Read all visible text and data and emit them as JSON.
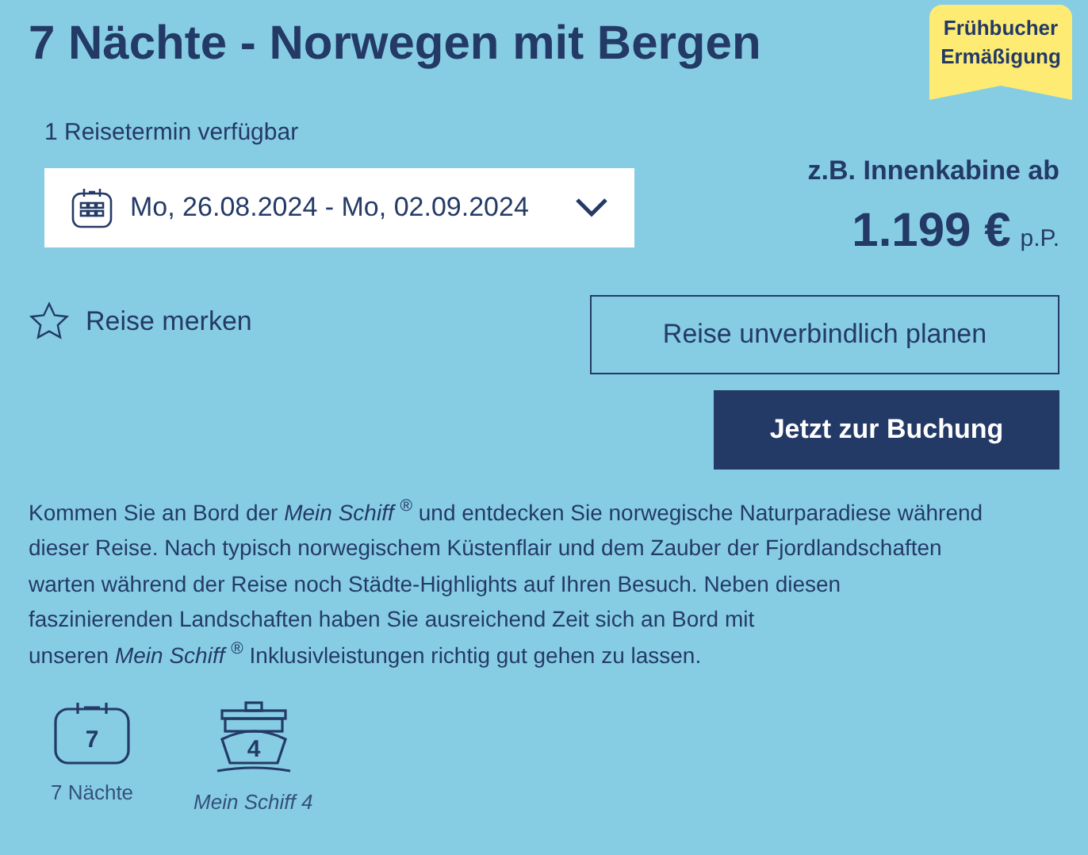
{
  "title": "7 Nächte - Norwegen mit Bergen",
  "badge": [
    "Frühbucher",
    "Ermäßigung"
  ],
  "availability": "1 Reisetermin verfügbar",
  "date_select": {
    "value": "Mo, 26.08.2024 - Mo, 02.09.2024"
  },
  "price": {
    "label": "z.B. Innenkabine ab",
    "amount": "1.199 €",
    "unit": "p.P."
  },
  "bookmark": {
    "label": "Reise merken",
    "selected": false
  },
  "buttons": [
    {
      "kind": "outline",
      "label": "Reise unverbindlich planen"
    },
    {
      "kind": "solid",
      "label": "Jetzt zur Buchung"
    }
  ],
  "description_lines": [
    "Kommen Sie an Bord der *Mein Schiff* $^{®}$ und entdecken Sie norwegische Naturparadiese während",
    "dieser Reise. Nach typisch norwegischem Küstenflair und dem Zauber der Fjordlandschaften",
    "warten während der Reise noch Städte-Highlights auf Ihren Besuch. Neben diesen",
    "faszinierenden Landschaften haben Sie ausreichend Zeit sich an Bord mit",
    "unseren *Mein Schiff* $^{®}$ Inklusivleistungen richtig gut gehen zu lassen."
  ],
  "facts": [
    {
      "kind": "calendar",
      "icon_text": "7",
      "label": "7 Nächte"
    },
    {
      "kind": "ship",
      "icon_text": "4",
      "label": "Mein Schiff 4"
    }
  ]
}
